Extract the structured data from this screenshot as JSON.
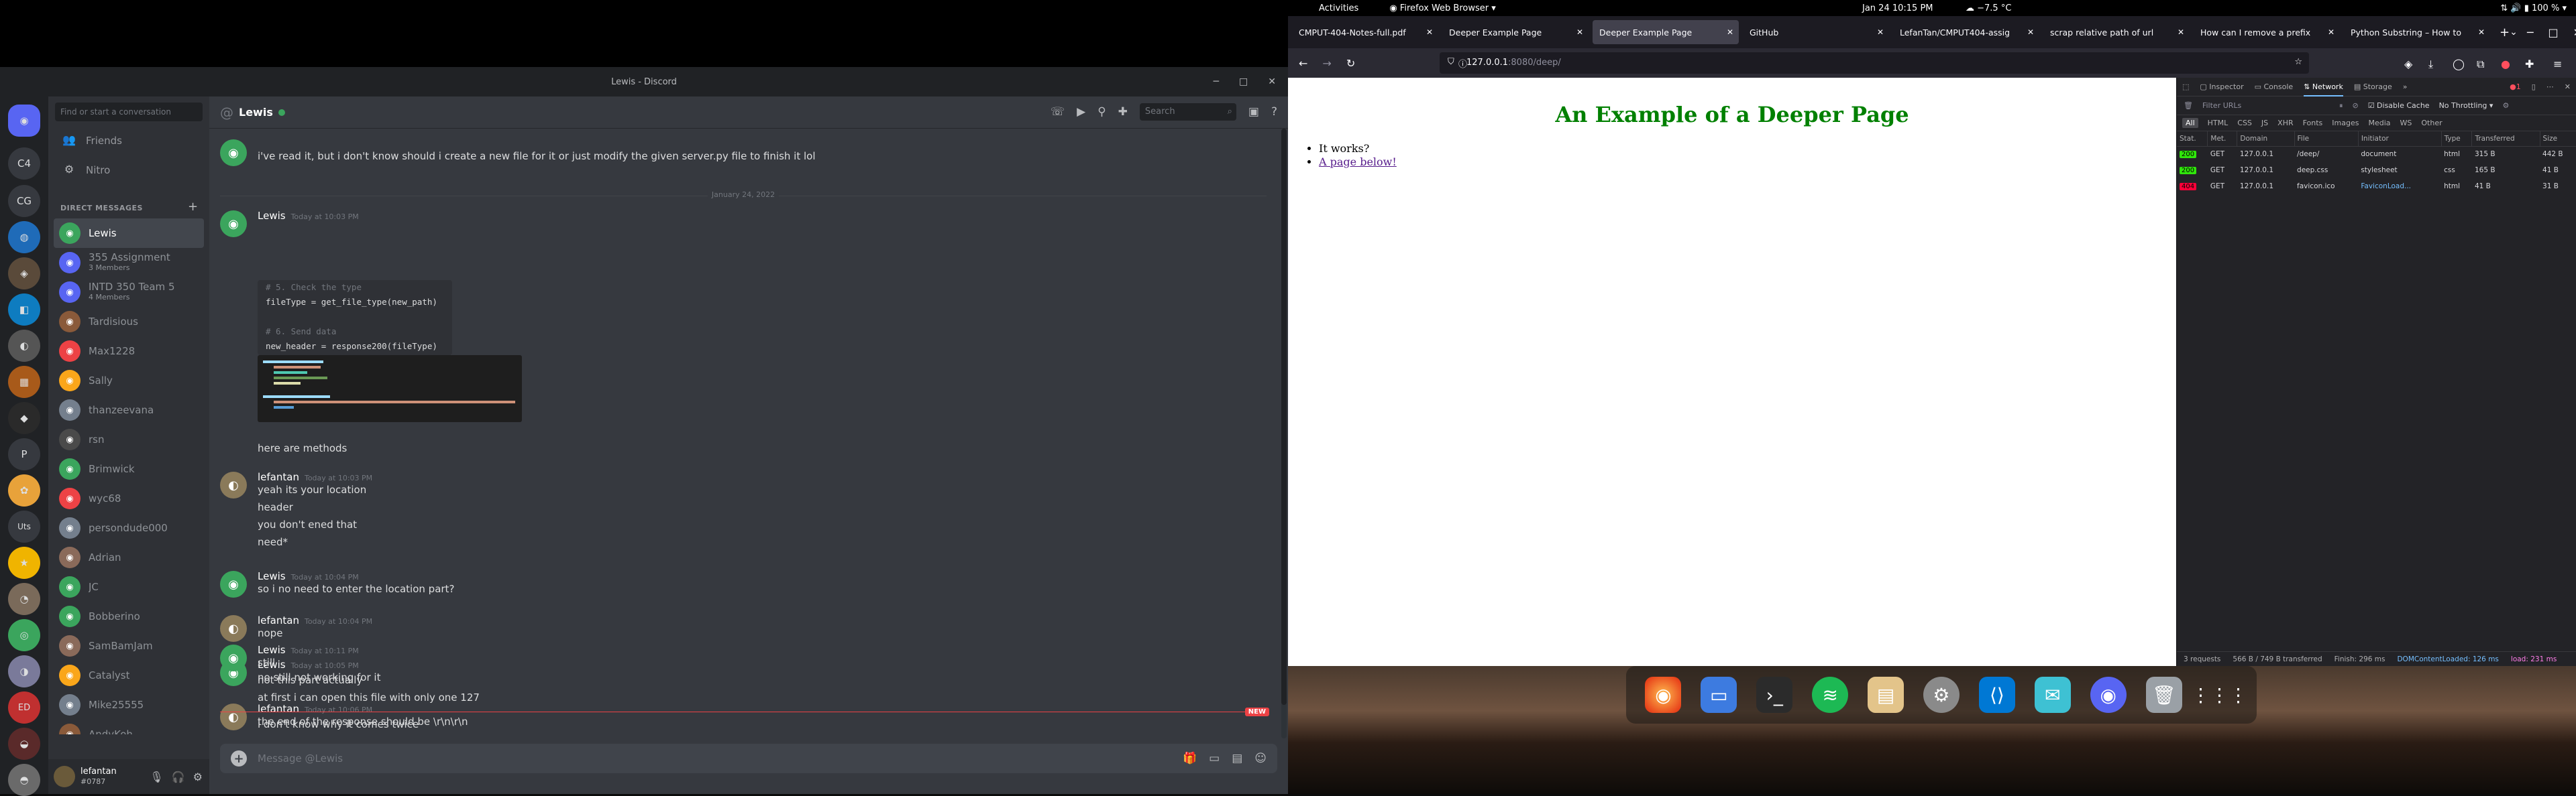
{
  "discord": {
    "window_title": "Lewis - Discord",
    "search_placeholder": "Find or start a conversation",
    "friends_label": "Friends",
    "nitro_label": "Nitro",
    "dm_header": "DIRECT MESSAGES",
    "guilds": [
      "C4",
      "CG",
      "P",
      "Uts",
      "ED"
    ],
    "dms": [
      {
        "name": "Lewis",
        "sub": "",
        "color": "#3ba55d",
        "active": true
      },
      {
        "name": "355 Assignment",
        "sub": "3 Members",
        "color": "#5865f2"
      },
      {
        "name": "INTD 350 Team 5",
        "sub": "4 Members",
        "color": "#5865f2"
      },
      {
        "name": "Tardisious",
        "sub": "",
        "color": "#8a5a3a"
      },
      {
        "name": "Max1228",
        "sub": "",
        "color": "#ed4245"
      },
      {
        "name": "Sally",
        "sub": "",
        "color": "#faa61a"
      },
      {
        "name": "thanzeevana",
        "sub": "",
        "color": "#747f8d"
      },
      {
        "name": "rsn",
        "sub": "",
        "color": "#4a4a4a"
      },
      {
        "name": "Brimwick",
        "sub": "",
        "color": "#3ba55d"
      },
      {
        "name": "wyc68",
        "sub": "",
        "color": "#ed4245"
      },
      {
        "name": "persondude000",
        "sub": "",
        "color": "#747f8d"
      },
      {
        "name": "Adrian",
        "sub": "",
        "color": "#8a6a5a"
      },
      {
        "name": "JC",
        "sub": "",
        "color": "#3ba55d"
      },
      {
        "name": "Bobberino",
        "sub": "",
        "color": "#3ba55d"
      },
      {
        "name": "SamBamJam",
        "sub": "",
        "color": "#8a6a5a"
      },
      {
        "name": "Catalyst",
        "sub": "",
        "color": "#faa61a"
      },
      {
        "name": "Mike25555",
        "sub": "",
        "color": "#747f8d"
      },
      {
        "name": "AndyKoh",
        "sub": "",
        "color": "#8a5a3a"
      }
    ],
    "user": {
      "name": "lefantan",
      "tag": "#0787"
    },
    "chat": {
      "title": "Lewis",
      "search_label": "Search",
      "date_divider": "January 24, 2022",
      "first_line": "i've read it, but i don't know should i create a new file for it or just modify the given server.py file to finish it lol",
      "messages": [
        {
          "author": "Lewis",
          "time": "Today at 10:03 PM",
          "lines": [
            "here are methods"
          ]
        },
        {
          "author": "lefantan",
          "time": "Today at 10:03 PM",
          "lines": [
            "yeah its your location",
            "header",
            "you don't ened that",
            "need*"
          ]
        },
        {
          "author": "Lewis",
          "time": "Today at 10:04 PM",
          "lines": [
            "so i no need to enter the location part?"
          ]
        },
        {
          "author": "lefantan",
          "time": "Today at 10:04 PM",
          "lines": [
            "nope"
          ]
        },
        {
          "author": "Lewis",
          "time": "Today at 10:05 PM",
          "lines": [
            "no still not working for it"
          ]
        },
        {
          "author": "lefantan",
          "time": "Today at 10:06 PM",
          "lines": [
            "the end of the response should be \\r\\n\\r\\n"
          ]
        },
        {
          "author": "Lewis",
          "time": "Today at 10:11 PM",
          "lines": [
            "still",
            "not this part actually",
            "at first i can open this file with only one 127"
          ]
        }
      ],
      "code_lines": [
        "# 5. Check the type",
        "fileType = get_file_type(new_path)",
        "",
        "# 6. Send data",
        "new_header = response200(fileType)"
      ],
      "new_badge": "NEW",
      "last_line": "i don't know why it comes twice",
      "composer_placeholder": "Message @Lewis"
    }
  },
  "gnome": {
    "activities": "Activities",
    "app": "Firefox Web Browser",
    "clock": "Jan 24  10:15 PM",
    "weather": "−7.5 °C",
    "battery": "100 %"
  },
  "firefox": {
    "tabs": [
      {
        "title": "CMPUT-404-Notes-full.pdf",
        "active": false
      },
      {
        "title": "Deeper Example Page",
        "active": false
      },
      {
        "title": "Deeper Example Page",
        "active": true
      },
      {
        "title": "GitHub",
        "active": false
      },
      {
        "title": "LefanTan/CMPUT404-assig",
        "active": false
      },
      {
        "title": "scrap relative path of url",
        "active": false
      },
      {
        "title": "How can I remove a prefix",
        "active": false
      },
      {
        "title": "Python Substring – How to",
        "active": false
      }
    ],
    "url_host": "127.0.0.1",
    "url_path": ":8080/deep/",
    "page": {
      "heading": "An Example of a Deeper Page",
      "items": [
        "It works?"
      ],
      "link": "A page below!"
    },
    "devtools": {
      "tabs": [
        "Inspector",
        "Console",
        "Network",
        "Storage"
      ],
      "active_tab": "Network",
      "filter_placeholder": "Filter URLs",
      "disable_cache": "Disable Cache",
      "throttling": "No Throttling",
      "types": [
        "All",
        "HTML",
        "CSS",
        "JS",
        "XHR",
        "Fonts",
        "Images",
        "Media",
        "WS",
        "Other"
      ],
      "columns": [
        "Stat.",
        "Met.",
        "Domain",
        "File",
        "Initiator",
        "Type",
        "Transferred",
        "Size"
      ],
      "rows": [
        {
          "status": "200",
          "method": "GET",
          "domain": "127.0.0.1",
          "file": "/deep/",
          "initiator": "document",
          "type": "html",
          "transferred": "315 B",
          "size": "442 B",
          "color": "#30e60b"
        },
        {
          "status": "200",
          "method": "GET",
          "domain": "127.0.0.1",
          "file": "deep.css",
          "initiator": "stylesheet",
          "type": "css",
          "transferred": "165 B",
          "size": "41 B",
          "color": "#30e60b"
        },
        {
          "status": "404",
          "method": "GET",
          "domain": "127.0.0.1",
          "file": "favicon.ico",
          "initiator": "FaviconLoad...",
          "type": "html",
          "transferred": "41 B",
          "size": "31 B",
          "color": "#ff0039"
        }
      ],
      "status_items": [
        "3 requests",
        "566 B / 749 B transferred",
        "Finish: 296 ms",
        "DOMContentLoaded: 126 ms",
        "load: 231 ms"
      ]
    }
  }
}
